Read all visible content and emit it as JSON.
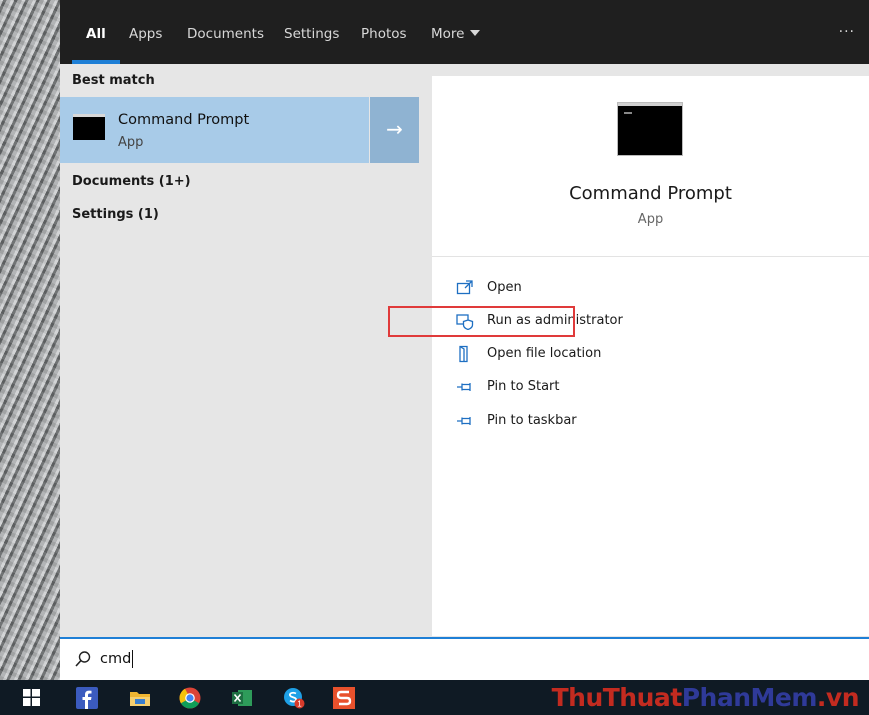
{
  "tabs": [
    {
      "label": "All",
      "active": true
    },
    {
      "label": "Apps"
    },
    {
      "label": "Documents"
    },
    {
      "label": "Settings"
    },
    {
      "label": "Photos"
    },
    {
      "label": "More"
    }
  ],
  "overflow_label": "···",
  "best_match": {
    "section_label": "Best match",
    "title": "Command Prompt",
    "subtitle": "App",
    "arrow": "→"
  },
  "categories": [
    "Documents (1+)",
    "Settings (1)"
  ],
  "preview": {
    "title": "Command Prompt",
    "subtitle": "App",
    "actions": [
      {
        "label": "Open",
        "icon": "open-icon"
      },
      {
        "label": "Run as administrator",
        "icon": "shield-admin-icon",
        "highlighted": true
      },
      {
        "label": "Open file location",
        "icon": "file-location-icon"
      },
      {
        "label": "Pin to Start",
        "icon": "pin-icon"
      },
      {
        "label": "Pin to taskbar",
        "icon": "pin-icon"
      }
    ]
  },
  "search": {
    "value": "cmd"
  },
  "taskbar": {
    "icons": [
      "windows-start-icon",
      "facebook-icon",
      "file-explorer-icon",
      "chrome-icon",
      "excel-icon",
      "skype-icon",
      "app-s-icon"
    ],
    "skype_badge": "1"
  },
  "watermark": {
    "part1": "ThuThuat",
    "part2": "PhanMem",
    "part3": ".vn"
  },
  "colors": {
    "accent": "#1e7fd6",
    "selection": "#a8cbe8",
    "highlight_box": "#e03a3a"
  }
}
